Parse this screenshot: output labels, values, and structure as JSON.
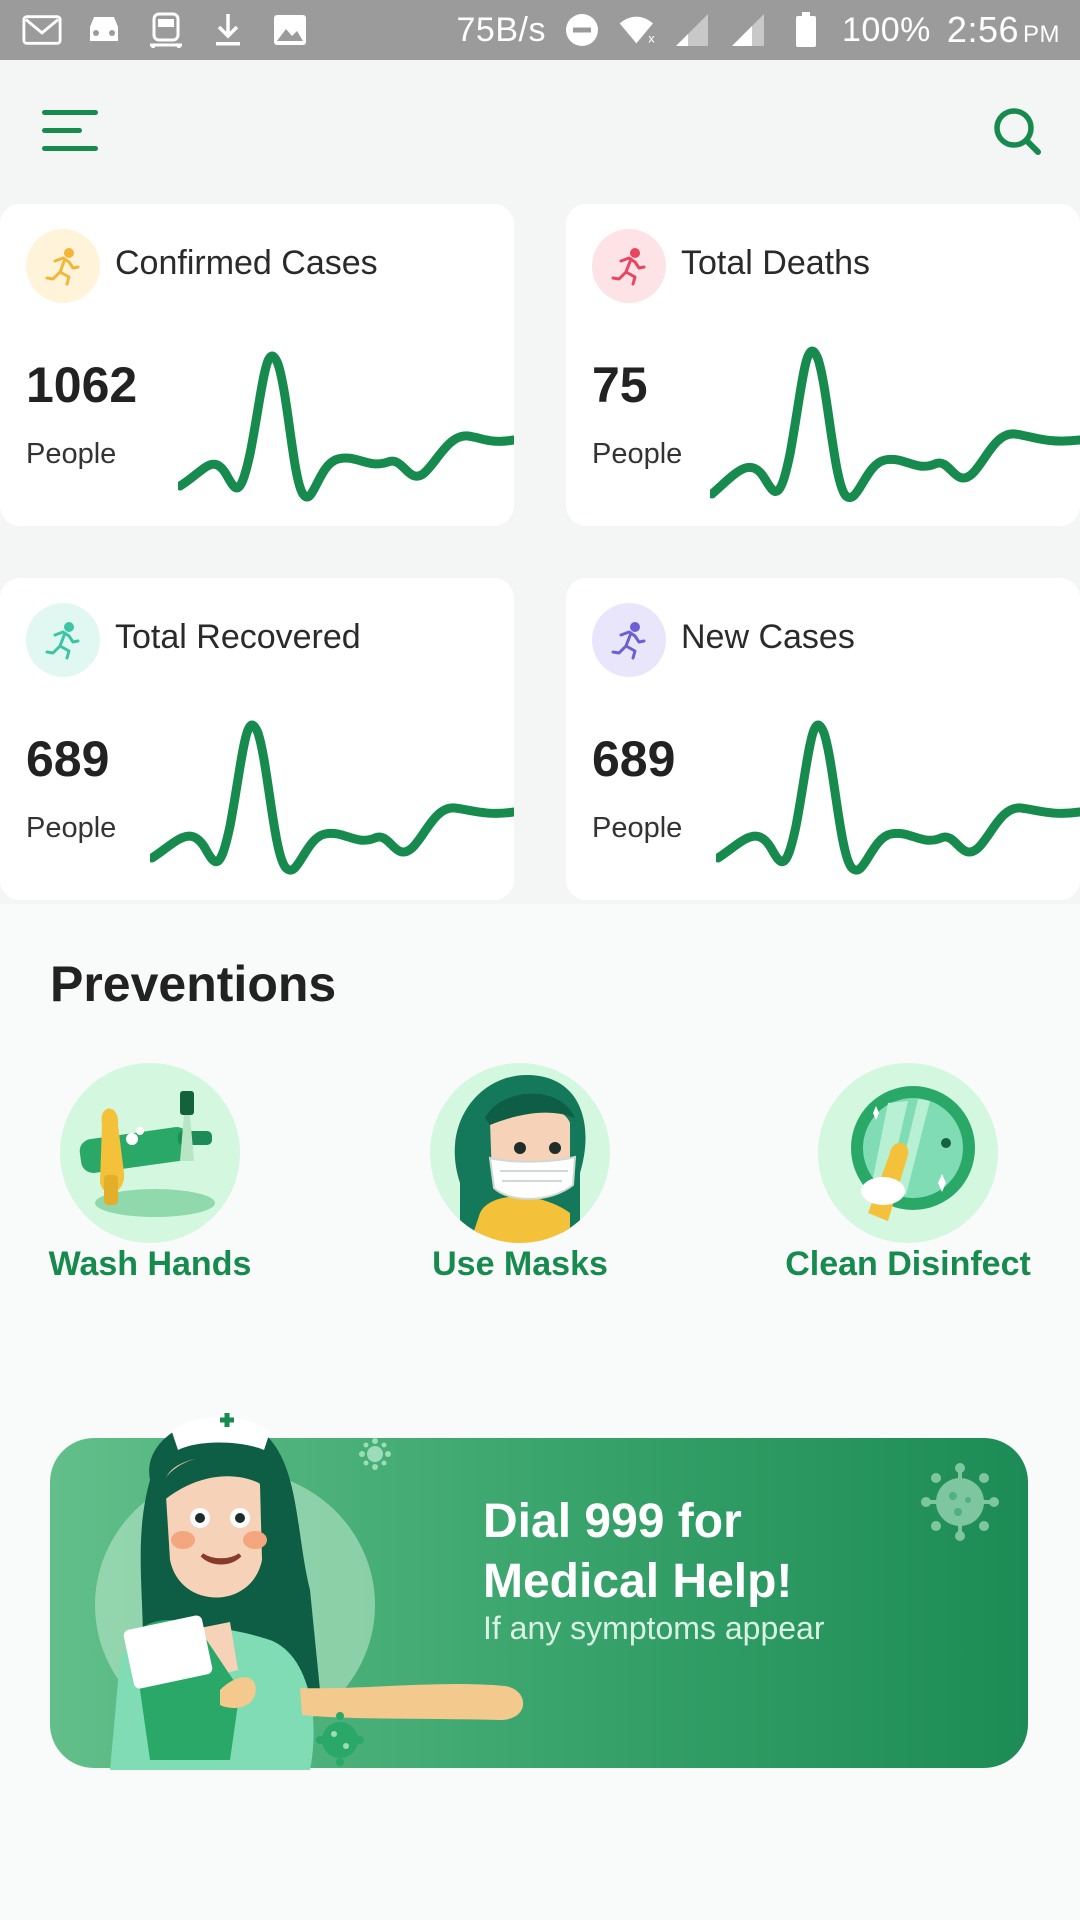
{
  "status_bar": {
    "icons": [
      "gmail-icon",
      "car-icon",
      "train-icon",
      "download-icon",
      "image-icon"
    ],
    "network_speed": "75B/s",
    "battery": "100%",
    "time": "2:56",
    "ampm": "PM"
  },
  "app_bar": {
    "menu_icon": "menu-icon",
    "search_icon": "search-icon",
    "accent_color": "#178a4e"
  },
  "stats": [
    {
      "title": "Confirmed Cases",
      "value": "1062",
      "unit": "People",
      "icon": "runner-icon",
      "icon_color": "#f3b63a",
      "icon_bg": "#fff4d9"
    },
    {
      "title": "Total Deaths",
      "value": "75",
      "unit": "People",
      "icon": "runner-icon",
      "icon_color": "#e8455f",
      "icon_bg": "#fde2e6"
    },
    {
      "title": "Total Recovered",
      "value": "689",
      "unit": "People",
      "icon": "runner-icon",
      "icon_color": "#3cc4a4",
      "icon_bg": "#e1f8f2"
    },
    {
      "title": "New Cases",
      "value": "689",
      "unit": "People",
      "icon": "runner-icon",
      "icon_color": "#6b5fd6",
      "icon_bg": "#e9e6fb"
    }
  ],
  "preventions": {
    "title": "Preventions",
    "items": [
      {
        "label": "Wash Hands",
        "icon": "wash-hands-icon"
      },
      {
        "label": "Use Masks",
        "icon": "mask-icon"
      },
      {
        "label": "Clean Disinfect",
        "icon": "disinfect-icon"
      }
    ]
  },
  "banner": {
    "title_line1": "Dial 999 for",
    "title_line2": "Medical Help!",
    "subtitle": "If any symptoms appear"
  }
}
